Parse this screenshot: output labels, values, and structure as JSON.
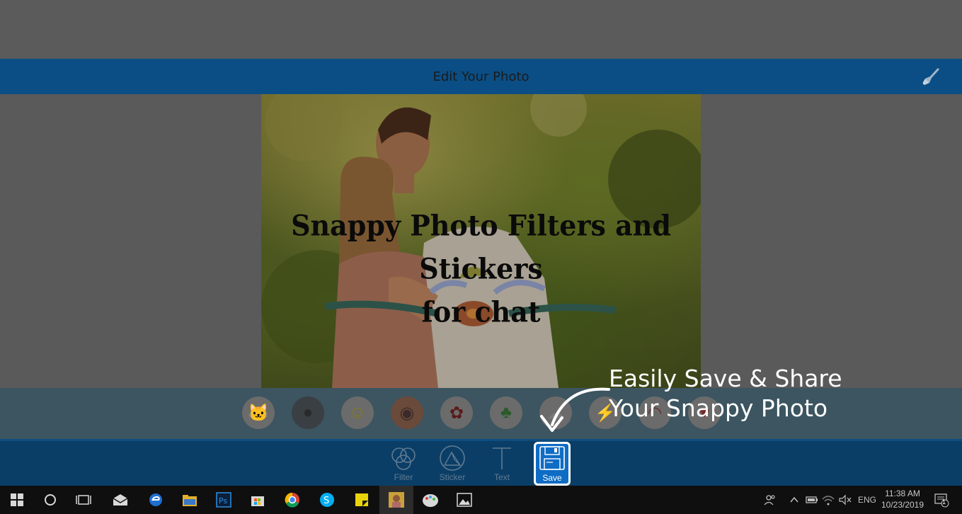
{
  "header": {
    "title": "Edit Your Photo",
    "brush_icon": "brush-icon"
  },
  "photo": {
    "caption_line1": "Snappy Photo Filters and Stickers",
    "caption_line2": "for chat"
  },
  "stickers": [
    "cat-sticker",
    "girl-face-sticker",
    "smiley-sticker",
    "girl-glasses-sticker",
    "red-flower-sticker",
    "bunny-sticker",
    "cloud-sticker",
    "rock-sticker",
    "lips-sticker",
    "heart-sticker"
  ],
  "toolbar": {
    "filter_label": "Filter",
    "sticker_label": "Sticker",
    "text_label": "Text",
    "save_label": "Save"
  },
  "callout": {
    "line1": "Easily Save & Share",
    "line2": "Your Snappy Photo"
  },
  "taskbar": {
    "language": "ENG",
    "time": "11:38 AM",
    "date": "10/23/2019",
    "notification_count": "1"
  }
}
